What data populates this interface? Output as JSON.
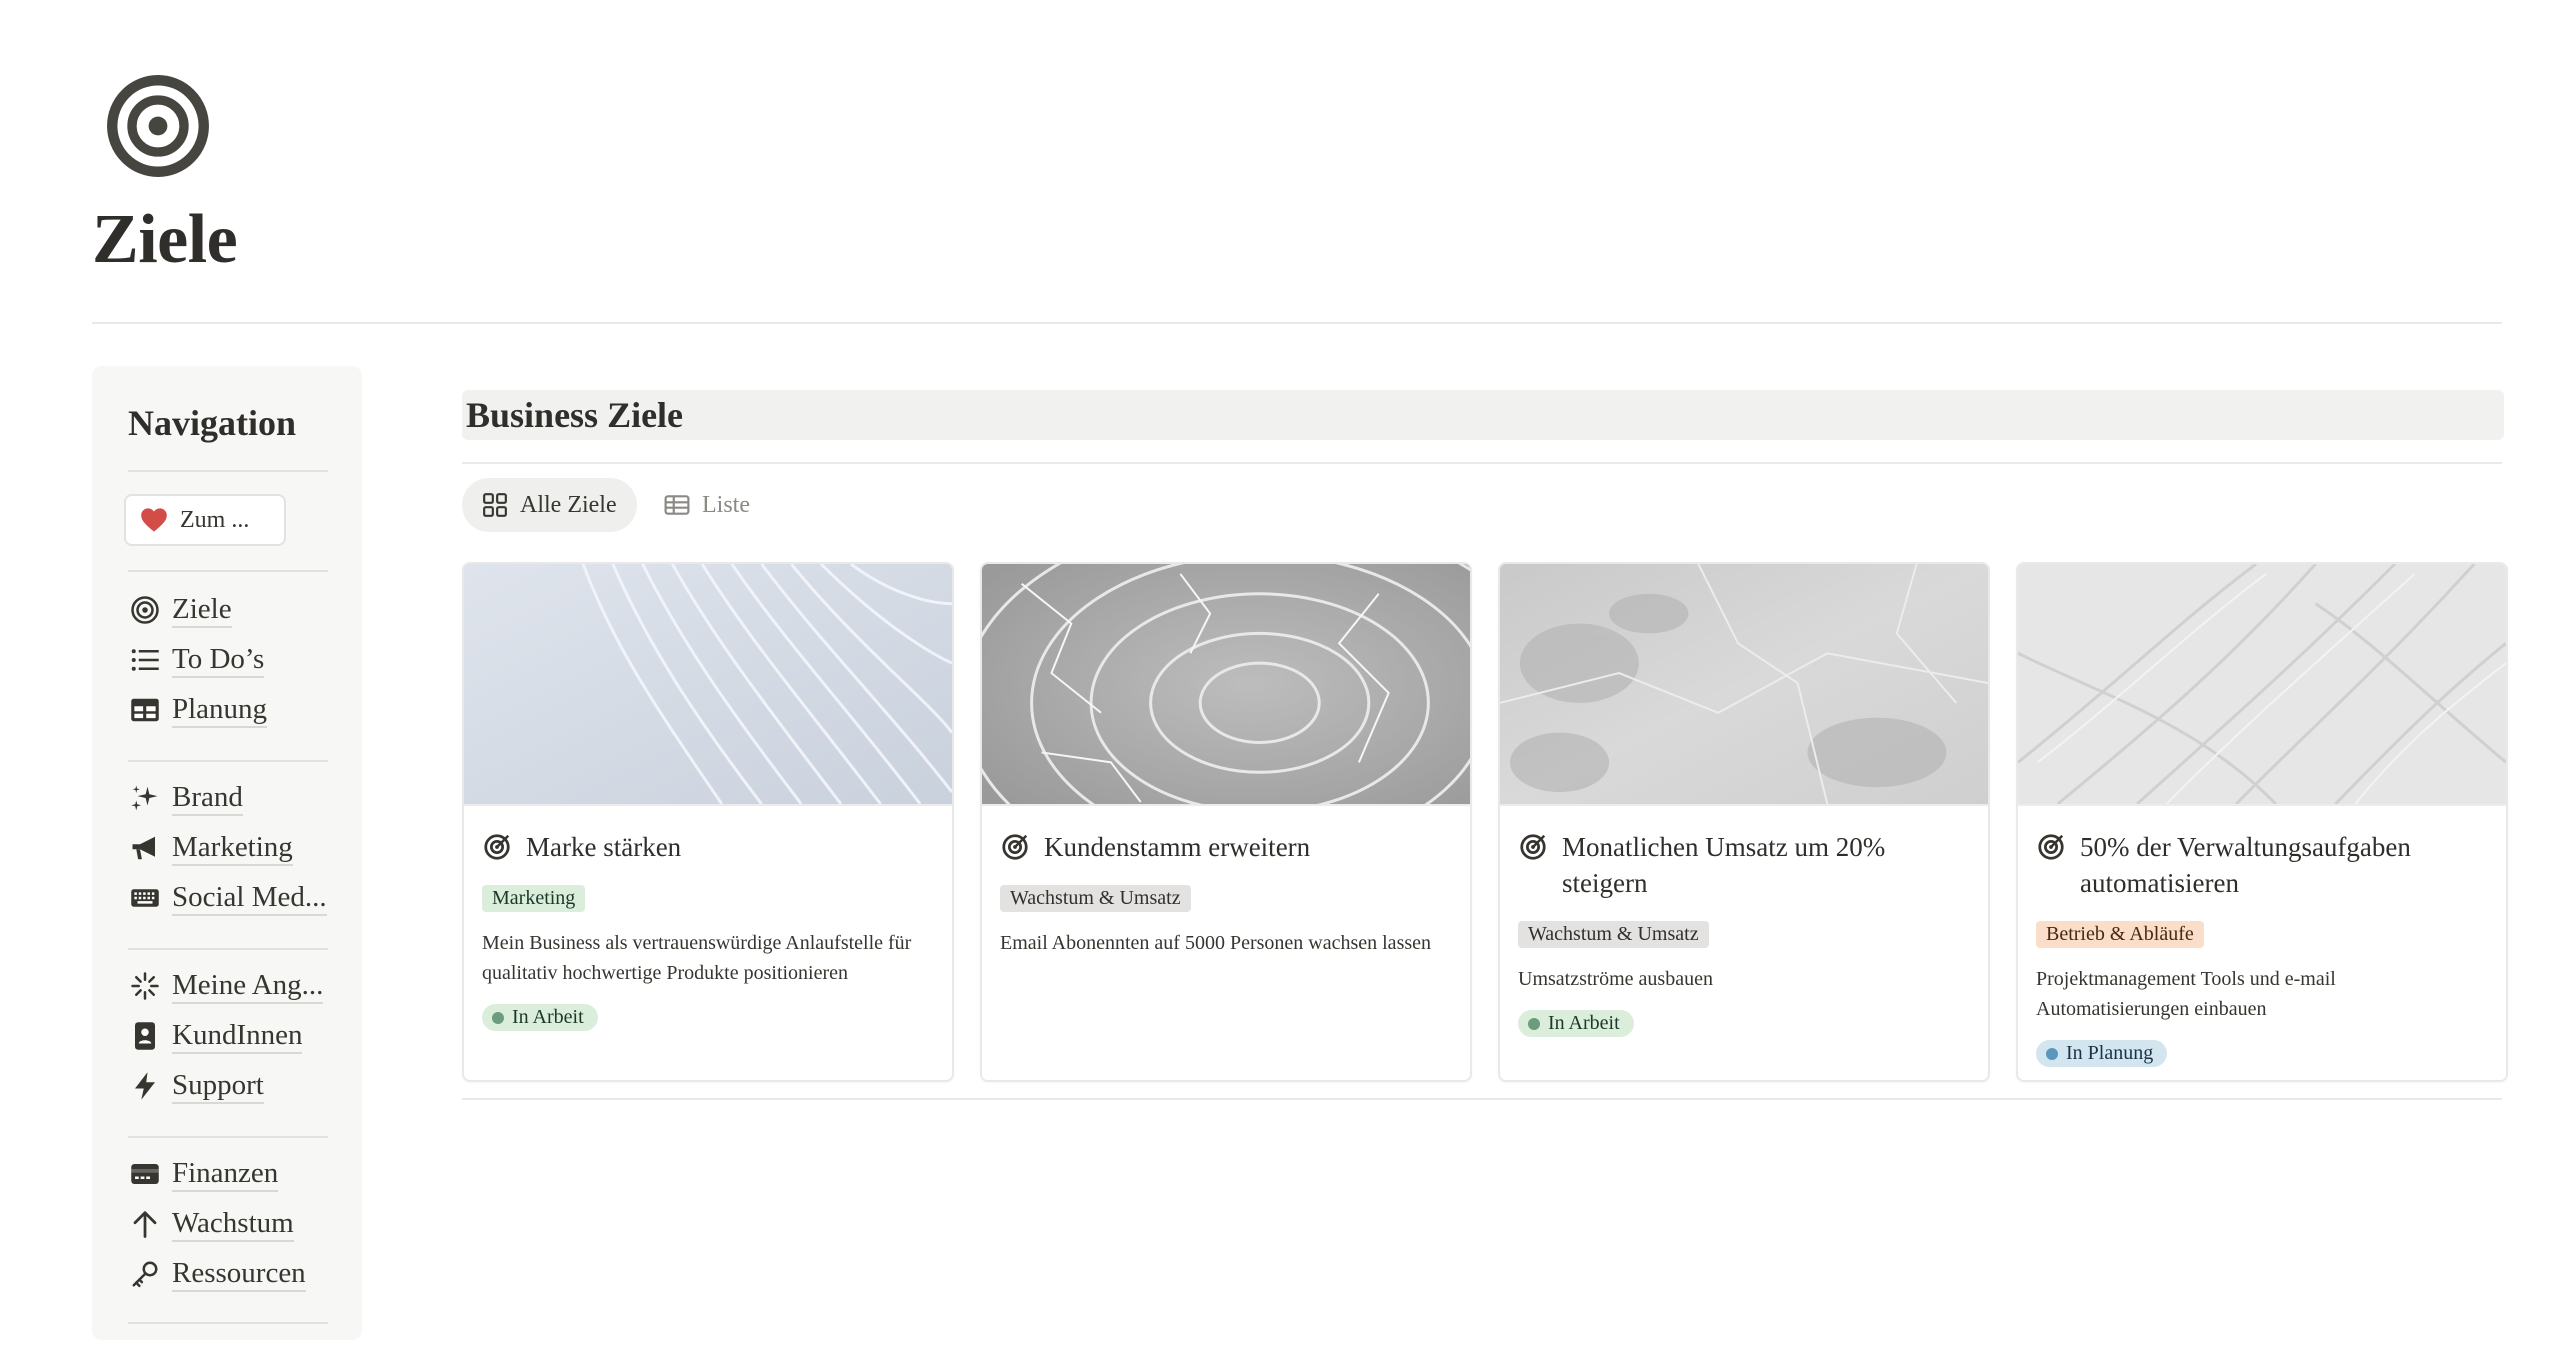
{
  "page": {
    "title": "Ziele",
    "icon": "target-icon"
  },
  "sidebar": {
    "heading": "Navigation",
    "pinned_button": {
      "label": "Zum ...",
      "icon": "heart-icon",
      "icon_color": "#e03e3e"
    },
    "groups": [
      [
        {
          "label": "Ziele",
          "icon": "target-icon"
        },
        {
          "label": "To Do’s",
          "icon": "list-icon"
        },
        {
          "label": "Planung",
          "icon": "table-icon"
        }
      ],
      [
        {
          "label": "Brand",
          "icon": "sparkles-icon"
        },
        {
          "label": "Marketing",
          "icon": "megaphone-icon"
        },
        {
          "label": "Social Med...",
          "icon": "keyboard-icon"
        }
      ],
      [
        {
          "label": "Meine Ang...",
          "icon": "loader-icon"
        },
        {
          "label": "KundInnen",
          "icon": "contact-card-icon"
        },
        {
          "label": "Support",
          "icon": "bolt-icon"
        }
      ],
      [
        {
          "label": "Finanzen",
          "icon": "credit-card-icon"
        },
        {
          "label": "Wachstum",
          "icon": "arrow-up-icon"
        },
        {
          "label": "Ressourcen",
          "icon": "key-icon"
        }
      ]
    ]
  },
  "database": {
    "title": "Business Ziele",
    "views": [
      {
        "label": "Alle Ziele",
        "icon": "gallery-icon",
        "active": true
      },
      {
        "label": "Liste",
        "icon": "table-icon",
        "active": false
      }
    ],
    "cards": [
      {
        "title": "Marke stärken",
        "cover": "white-waves",
        "tag": "Marketing",
        "tag_color": "green",
        "description": "Mein Business als vertrauenswürdige Anlaufstelle für qualitativ hochwertige Produkte positionieren",
        "status": "In Arbeit",
        "status_color": "green"
      },
      {
        "title": "Kundenstamm erweitern",
        "cover": "gray-texture",
        "tag": "Wachstum & Umsatz",
        "tag_color": "gray",
        "description": "Email Abonennten auf 5000 Personen wachsen lassen",
        "status": "",
        "status_color": ""
      },
      {
        "title": "Monatlichen Umsatz um 20% steigern",
        "cover": "marble",
        "tag": "Wachstum & Umsatz",
        "tag_color": "gray",
        "description": "Umsatzströme ausbauen",
        "status": "In Arbeit",
        "status_color": "green"
      },
      {
        "title": "50% der Verwaltungsaufgaben automatisieren",
        "cover": "plaster",
        "tag": "Betrieb & Abläufe",
        "tag_color": "orange",
        "description": "Projektmanagement Tools und e-mail Automatisierungen einbauen",
        "status": "In Planung",
        "status_color": "blue"
      }
    ]
  }
}
